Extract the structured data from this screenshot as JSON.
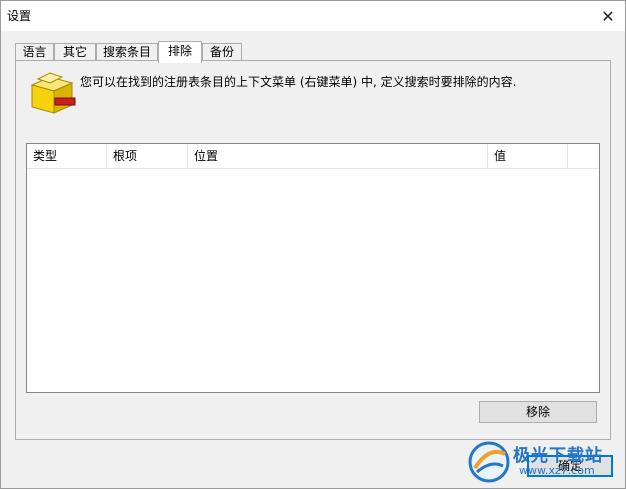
{
  "window": {
    "title": "设置",
    "close_glyph": "✕"
  },
  "tabs": [
    {
      "label": "语言"
    },
    {
      "label": "其它"
    },
    {
      "label": "搜索条目"
    },
    {
      "label": "排除",
      "active": true
    },
    {
      "label": "备份"
    }
  ],
  "panel": {
    "description": "您可以在找到的注册表条目的上下文菜单 (右键菜单) 中, 定义搜索时要排除的内容.",
    "icon": "folder-remove-icon",
    "columns": [
      "类型",
      "根项",
      "位置",
      "值"
    ],
    "rows": []
  },
  "buttons": {
    "remove": "移除",
    "ok": "确定"
  },
  "watermark": {
    "line1": "极光下载站",
    "line2": "www.xz7.com"
  },
  "colors": {
    "focus_border": "#0078d7",
    "icon_yellow": "#f5d20c",
    "icon_red": "#cc1f1f",
    "watermark": "#2476c8"
  }
}
